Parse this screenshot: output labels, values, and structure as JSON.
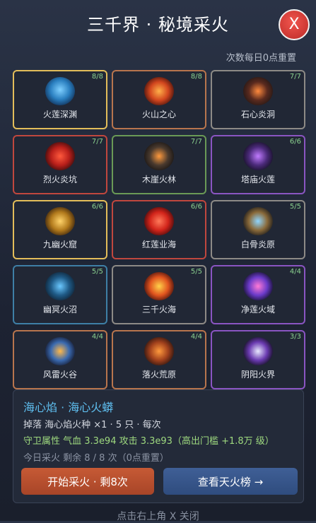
{
  "header": {
    "title": "三千界 · 秘境采火",
    "close_label": "X",
    "reset_note": "次数每日0点重置"
  },
  "colors": {
    "gold": "#e3bd5a",
    "orange": "#b8754d",
    "gray": "#8d8a86",
    "red": "#c0473e",
    "green": "#6a9a56",
    "purple": "#8a55c2",
    "blue": "#3e7fa6",
    "count_text": "#8bd28f",
    "accent_blue": "#5fbff0",
    "attr_green": "#9ed97f",
    "start_button": "#b84c2d",
    "rank_button": "#35558a"
  },
  "grid": [
    {
      "name": "火莲深渊",
      "count": "8/8",
      "border": "gold",
      "icon": "blue-dragon-icon"
    },
    {
      "name": "火山之心",
      "count": "8/8",
      "border": "orange",
      "icon": "lava-golem-icon"
    },
    {
      "name": "石心炎洞",
      "count": "7/7",
      "border": "gray",
      "icon": "rock-golem-icon"
    },
    {
      "name": "烈火炎坑",
      "count": "7/7",
      "border": "red",
      "icon": "fire-dragon-icon"
    },
    {
      "name": "木崖火林",
      "count": "7/7",
      "border": "green",
      "icon": "ember-beast-icon"
    },
    {
      "name": "塔庙火莲",
      "count": "6/6",
      "border": "purple",
      "icon": "shadow-mage-icon"
    },
    {
      "name": "九幽火窟",
      "count": "6/6",
      "border": "gold",
      "icon": "golden-dragon-icon"
    },
    {
      "name": "红莲业海",
      "count": "6/6",
      "border": "red",
      "icon": "red-orb-icon"
    },
    {
      "name": "白骨炎原",
      "count": "5/5",
      "border": "gray",
      "icon": "bone-warrior-icon"
    },
    {
      "name": "幽冥火沼",
      "count": "5/5",
      "border": "blue",
      "icon": "swamp-serpent-icon"
    },
    {
      "name": "三千火海",
      "count": "5/5",
      "border": "gray",
      "icon": "fire-flower-icon"
    },
    {
      "name": "净莲火域",
      "count": "4/4",
      "border": "purple",
      "icon": "nebula-orb-icon"
    },
    {
      "name": "风雷火谷",
      "count": "4/4",
      "border": "orange",
      "icon": "storm-griffin-icon"
    },
    {
      "name": "落火荒原",
      "count": "4/4",
      "border": "orange",
      "icon": "flame-spirit-icon"
    },
    {
      "name": "阴阳火界",
      "count": "3/3",
      "border": "purple",
      "icon": "yin-yang-spirit-icon"
    }
  ],
  "info": {
    "headline": "海心焰 · 海心火蟒",
    "drop": "掉落 海心焰火种 ×1 · 5 只 · 每次",
    "guardian": "守卫属性 气血 3.3e94 攻击 3.3e93（高出门槛 +1.8万 级）",
    "today": "今日采火 剩余 8 / 8 次（0点重置）",
    "start_button": "开始采火 · 剩8次",
    "rank_button": "查看天火榜 →"
  },
  "footer": "点击右上角 X 关闭"
}
